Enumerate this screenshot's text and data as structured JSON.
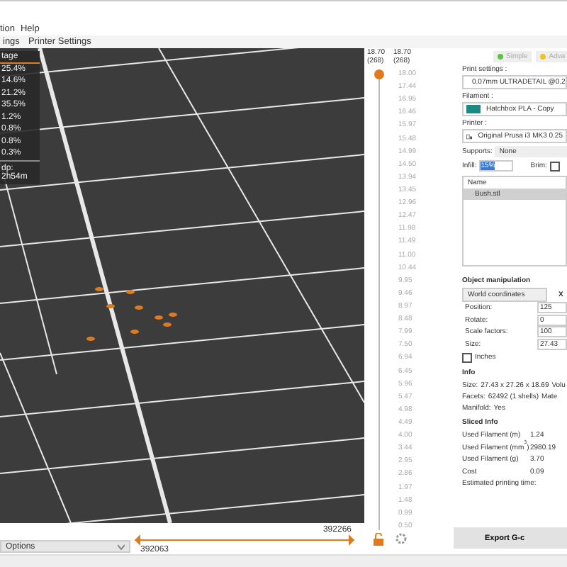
{
  "menu": [
    "tion",
    "Help"
  ],
  "tabs": [
    {
      "label": "ings",
      "selected": false
    },
    {
      "label": "Printer Settings",
      "selected": false
    }
  ],
  "legend": {
    "header": "tage",
    "rows": [
      "25.4%",
      "14.6%",
      "21.2%",
      "35.5%",
      "1.2%",
      "0.8%",
      "0.8%",
      "0.3%"
    ],
    "footer": "dp: 2h54m"
  },
  "view_options": "Options",
  "horizontal_slider": {
    "upper_label": "392266",
    "lower_label": "392063",
    "level": 1
  },
  "vertical_slider": {
    "level": 1,
    "top_labels": [
      {
        "value": "18.70",
        "layer": "(268)"
      },
      {
        "value": "18.70",
        "layer": "(268)"
      }
    ],
    "ticks": [
      "18.00",
      "17.44",
      "16.95",
      "16.46",
      "15.97",
      "15.48",
      "14.99",
      "14.50",
      "13.94",
      "13.45",
      "12.96",
      "12.47",
      "11.98",
      "11.49",
      "11.00",
      "10.44",
      "9.95",
      "9.46",
      "8.97",
      "8.48",
      "7.99",
      "7.50",
      "6.94",
      "6.45",
      "5.96",
      "5.47",
      "4.98",
      "4.49",
      "4.00",
      "3.44",
      "2.95",
      "2.86",
      "1.97",
      "1.48",
      "0.99",
      "0.50"
    ]
  },
  "mode_tabs": [
    {
      "label": "Simple",
      "color": "#5cc43a",
      "selected": false
    },
    {
      "label": "Adva",
      "color": "#f0c419",
      "selected": false
    }
  ],
  "print_settings": {
    "label": "Print settings :",
    "value": "0.07mm ULTRADETAIL @0.2"
  },
  "filament": {
    "label": "Filament :",
    "value": "Hatchbox PLA - Copy",
    "color": "#1a8a84"
  },
  "printer": {
    "label": "Printer :",
    "value": "Original Prusa i3 MK3 0.25"
  },
  "supports": {
    "label": "Supports:",
    "value": "None"
  },
  "infill": {
    "label": "Infill:",
    "value": "15%"
  },
  "brim": {
    "label": "Brim:",
    "checked": false
  },
  "objects": {
    "header": "Name",
    "items": [
      {
        "name": "Bush.stl",
        "selected": true
      }
    ]
  },
  "object_manipulation": {
    "title": "Object manipulation",
    "coordinates": "World coordinates",
    "axis": "X",
    "rows": [
      {
        "label": "Position:",
        "value": "125"
      },
      {
        "label": "Rotate:",
        "value": "0"
      },
      {
        "label": "Scale factors:",
        "value": "100"
      },
      {
        "label": "Size:",
        "value": "27.43"
      }
    ],
    "inches": {
      "label": "Inches",
      "checked": false
    }
  },
  "info": {
    "title": "Info",
    "rows": [
      {
        "label": "Size:",
        "value": "27.43 x 27.26 x 18.69",
        "extra": "Volu"
      },
      {
        "label": "Facets:",
        "value": "62492 (1 shells)",
        "extra": "Mate"
      },
      {
        "label": "Manifold:",
        "value": "Yes"
      }
    ]
  },
  "sliced_info": {
    "title": "Sliced Info",
    "rows": [
      {
        "label": "Used Filament (m)",
        "value": "1.24"
      },
      {
        "label": "Used Filament (mm$^{3}$)",
        "value": "2980.19"
      },
      {
        "label": "Used Filament (g)",
        "value": "3.70"
      },
      {
        "label": "Cost",
        "value": "0.09"
      },
      {
        "label": "Estimated printing time:"
      }
    ]
  },
  "export_button": "Export G-c"
}
